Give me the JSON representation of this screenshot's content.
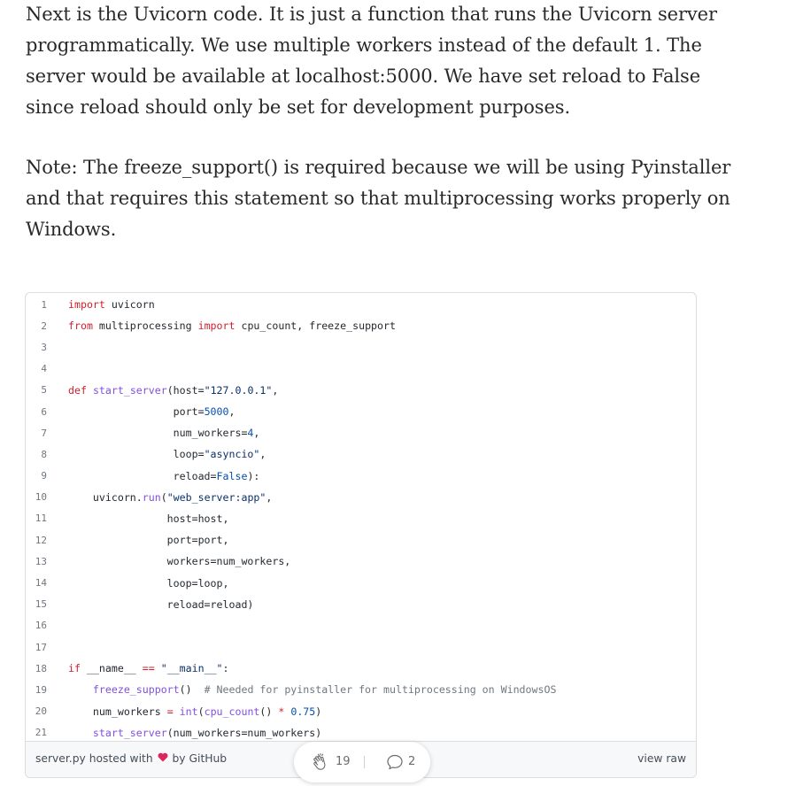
{
  "paragraphs": [
    "Next is the Uvicorn code. It is just a function that runs the Uvicorn server programmatically. We use multiple workers instead of the default 1. The server would be available at localhost:5000. We have set reload to False since reload should only be set for development purposes.",
    "Note: The freeze_support() is required because we will be using Pyinstaller and that requires this statement so that multiprocessing works properly on Windows."
  ],
  "gist": {
    "lines": [
      {
        "n": "1",
        "html": "<span class=\"kw\">import</span> uvicorn"
      },
      {
        "n": "2",
        "html": "<span class=\"kw\">from</span> multiprocessing <span class=\"kw\">import</span> cpu_count, freeze_support"
      },
      {
        "n": "3",
        "html": ""
      },
      {
        "n": "4",
        "html": ""
      },
      {
        "n": "5",
        "html": "<span class=\"kw\">def</span> <span class=\"fn\">start_server</span>(host=<span class=\"str\">\"127.0.0.1\"</span>,"
      },
      {
        "n": "6",
        "html": "                 port=<span class=\"num\">5000</span>,"
      },
      {
        "n": "7",
        "html": "                 num_workers=<span class=\"num\">4</span>,"
      },
      {
        "n": "8",
        "html": "                 loop=<span class=\"str\">\"asyncio\"</span>,"
      },
      {
        "n": "9",
        "html": "                 reload=<span class=\"num\">False</span>):"
      },
      {
        "n": "10",
        "html": "    uvicorn.<span class=\"fn\">run</span>(<span class=\"str\">\"web_server:app\"</span>,"
      },
      {
        "n": "11",
        "html": "                host=host,"
      },
      {
        "n": "12",
        "html": "                port=port,"
      },
      {
        "n": "13",
        "html": "                workers=num_workers,"
      },
      {
        "n": "14",
        "html": "                loop=loop,"
      },
      {
        "n": "15",
        "html": "                reload=reload)"
      },
      {
        "n": "16",
        "html": ""
      },
      {
        "n": "17",
        "html": ""
      },
      {
        "n": "18",
        "html": "<span class=\"kw\">if</span> __name__ <span class=\"kw\">==</span> <span class=\"str\">\"__main__\"</span>:"
      },
      {
        "n": "19",
        "html": "    <span class=\"fn\">freeze_support</span>()  <span class=\"cm\"># Needed for pyinstaller for multiprocessing on WindowsOS</span>"
      },
      {
        "n": "20",
        "html": "    num_workers <span class=\"kw\">=</span> <span class=\"fn\">int</span>(<span class=\"fn\">cpu_count</span>() <span class=\"kw\">*</span> <span class=\"num\">0.75</span>)"
      },
      {
        "n": "21",
        "html": "    <span class=\"fn\">start_server</span>(num_workers=num_workers)"
      }
    ],
    "footer": {
      "filename": "server.py",
      "hosted_with": "hosted with",
      "by": "by",
      "github": "GitHub",
      "view_raw": "view raw"
    }
  },
  "claps": {
    "count": "19",
    "responses": "2",
    "clap_icon": "clap-icon",
    "response_icon": "speech-bubble-icon"
  },
  "colors": {
    "text": "#292929",
    "heart": "#e0245e",
    "keyword": "#cf222e",
    "function": "#8250df",
    "string": "#0a3069",
    "number": "#0550ae"
  }
}
